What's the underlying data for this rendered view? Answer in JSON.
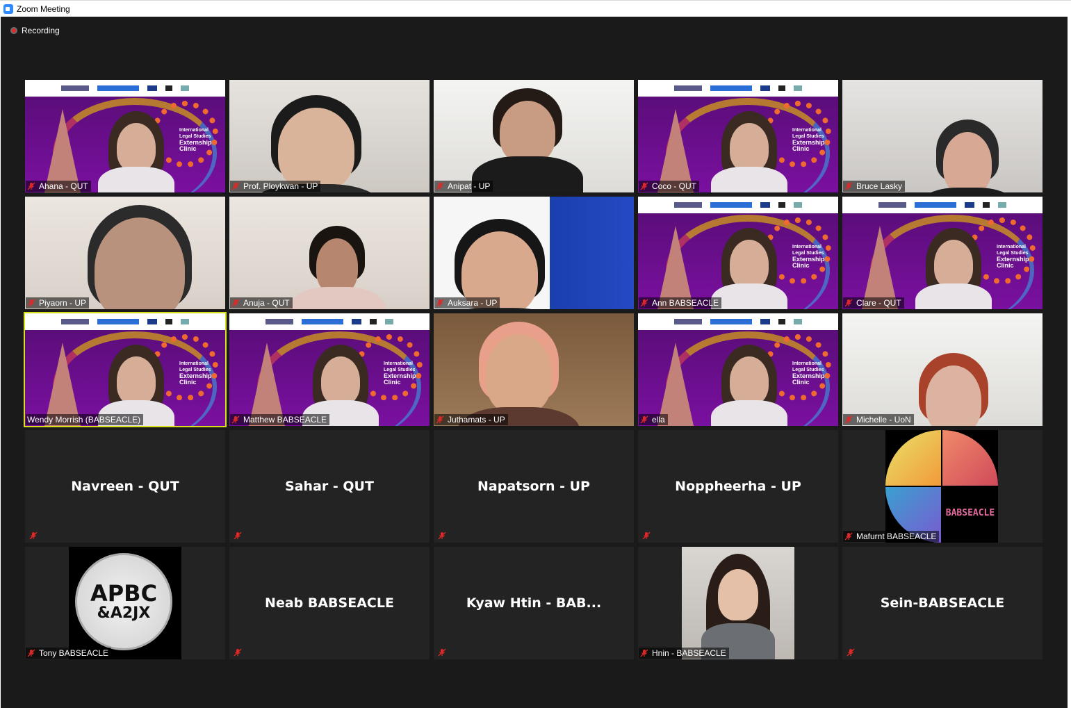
{
  "window": {
    "title": "Zoom Meeting"
  },
  "status": {
    "recording_label": "Recording"
  },
  "banner": {
    "clinic_line1": "International",
    "clinic_line2": "Legal Studies",
    "clinic_line3": "Externship",
    "clinic_line4": "Clinic"
  },
  "participants": [
    {
      "name": "Ahana - QUT",
      "video": "clinic-banner"
    },
    {
      "name": "Prof. Ploykwan - UP",
      "video": "camera"
    },
    {
      "name": "Anipat - UP",
      "video": "camera"
    },
    {
      "name": "Coco - QUT",
      "video": "clinic-banner"
    },
    {
      "name": "Bruce Lasky",
      "video": "camera"
    },
    {
      "name": "Piyaorn - UP",
      "video": "camera"
    },
    {
      "name": "Anuja - QUT",
      "video": "camera"
    },
    {
      "name": "Auksara - UP",
      "video": "camera"
    },
    {
      "name": "Ann BABSEACLE",
      "video": "clinic-banner"
    },
    {
      "name": "Clare - QUT",
      "video": "clinic-banner"
    },
    {
      "name": "Wendy Morrish (BABSEACLE)",
      "video": "clinic-banner",
      "active_speaker": true
    },
    {
      "name": "Matthew BABSEACLE",
      "video": "clinic-banner"
    },
    {
      "name": "Juthamats - UP",
      "video": "camera"
    },
    {
      "name": "ella",
      "video": "clinic-banner"
    },
    {
      "name": "Michelle - UoN",
      "video": "camera"
    },
    {
      "name": "Navreen - QUT",
      "video": "off"
    },
    {
      "name": "Sahar - QUT",
      "video": "off"
    },
    {
      "name": "Napatsorn - UP",
      "video": "off"
    },
    {
      "name": "Noppheerha - UP",
      "video": "off"
    },
    {
      "name": "Mafurnt BABSEACLE",
      "video": "profile-picture"
    },
    {
      "name": "Tony BABSEACLE",
      "video": "profile-picture"
    },
    {
      "name": "Neab BABSEACLE",
      "video": "off"
    },
    {
      "name": "Kyaw Htin - BAB...",
      "video": "off"
    },
    {
      "name": "Hnin - BABSEACLE",
      "video": "profile-picture"
    },
    {
      "name": "Sein-BABSEACLE",
      "video": "off"
    }
  ],
  "profile_badges": {
    "mafurnt_text": "BABSEACLE",
    "tony_line1": "APBC",
    "tony_line2": "&A2JX"
  },
  "colors": {
    "window_bg": "#1a1a1a",
    "tile_bg": "#232323",
    "active_speaker_border": "#d7e01a",
    "muted_icon": "#e02828",
    "banner_purple": "#7a10a0"
  },
  "icons": {
    "muted": "mic-muted-icon",
    "recording": "recording-dot-icon",
    "app": "zoom-logo-icon"
  }
}
